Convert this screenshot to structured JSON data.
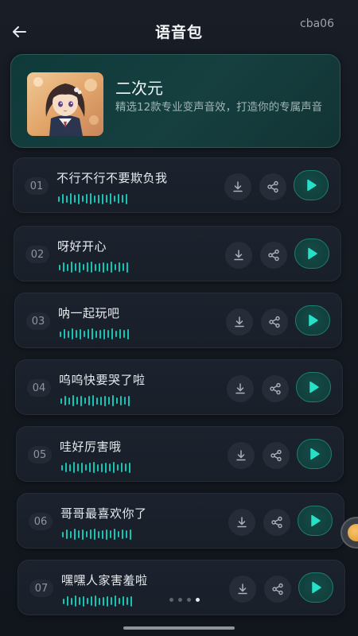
{
  "header": {
    "title": "语音包",
    "account": "cba06"
  },
  "pack": {
    "name": "二次元",
    "description": "精选12款专业变声音效，打造你的专属声音"
  },
  "items": [
    {
      "num": "01",
      "title": "不行不行不要欺负我"
    },
    {
      "num": "02",
      "title": "呀好开心"
    },
    {
      "num": "03",
      "title": "呐一起玩吧"
    },
    {
      "num": "04",
      "title": "呜呜快要哭了啦"
    },
    {
      "num": "05",
      "title": "哇好厉害哦"
    },
    {
      "num": "06",
      "title": "哥哥最喜欢你了"
    },
    {
      "num": "07",
      "title": "嘿嘿人家害羞啦"
    }
  ],
  "pagination": {
    "count": 4,
    "active_index": 3
  },
  "colors": {
    "accent": "#19c2b3",
    "card": "#163f40",
    "background": "#141920"
  },
  "icons": {
    "back": "arrow-left-icon",
    "download": "download-icon",
    "share": "share-icon",
    "play": "play-icon"
  }
}
